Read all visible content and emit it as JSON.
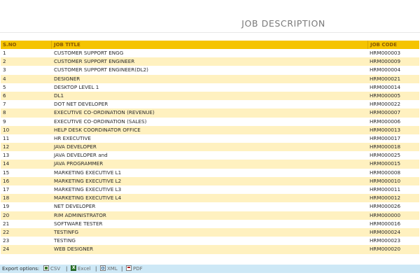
{
  "page_title": "JOB DESCRIPTION",
  "table": {
    "columns": [
      "S.NO",
      "JOB TITLE",
      "JOB CODE"
    ],
    "rows": [
      {
        "sno": "1",
        "title": "CUSTOMER SUPPORT ENGG",
        "code": "HRM000003"
      },
      {
        "sno": "2",
        "title": "CUSTOMER SUPPORT ENGINEER",
        "code": "HRM000009"
      },
      {
        "sno": "3",
        "title": "CUSTOMER SUPPORT ENGINEER(DL2)",
        "code": "HRM000004"
      },
      {
        "sno": "4",
        "title": "DESIGNER",
        "code": "HRM000021"
      },
      {
        "sno": "5",
        "title": "DESKTOP LEVEL 1",
        "code": "HRM000014"
      },
      {
        "sno": "6",
        "title": "DL1",
        "code": "HRM000005"
      },
      {
        "sno": "7",
        "title": "DOT NET DEVELOPER",
        "code": "HRM000022"
      },
      {
        "sno": "8",
        "title": "EXECUTIVE CO-ORDINATION (REVENUE)",
        "code": "HRM000007"
      },
      {
        "sno": "9",
        "title": "EXECUTIVE CO-ORDINATION (SALES)",
        "code": "HRM000006"
      },
      {
        "sno": "10",
        "title": "HELP DESK COORDINATOR OFFICE",
        "code": "HRM000013"
      },
      {
        "sno": "11",
        "title": "HR EXECUTIVE",
        "code": "HRM000017"
      },
      {
        "sno": "12",
        "title": "JAVA DEVELOPER",
        "code": "HRM000018"
      },
      {
        "sno": "13",
        "title": "JAVA DEVELOPER and",
        "code": "HRM000025"
      },
      {
        "sno": "14",
        "title": "JAVA PROGRAMMER",
        "code": "HRM000015"
      },
      {
        "sno": "15",
        "title": "MARKETING EXECUTIVE L1",
        "code": "HRM000008"
      },
      {
        "sno": "16",
        "title": "MARKETING EXECUTIVE L2",
        "code": "HRM000010"
      },
      {
        "sno": "17",
        "title": "MARKETING EXECUTIVE L3",
        "code": "HRM000011"
      },
      {
        "sno": "18",
        "title": "MARKETING EXECUTIVE L4",
        "code": "HRM000012"
      },
      {
        "sno": "19",
        "title": "NET DEVELOPER",
        "code": "HRM000026"
      },
      {
        "sno": "20",
        "title": "RIM ADMINISTRATOR",
        "code": "HRM000000"
      },
      {
        "sno": "21",
        "title": "SOFTWARE TESTER",
        "code": "HRM000016"
      },
      {
        "sno": "22",
        "title": "TESTINFG",
        "code": "HRM000024"
      },
      {
        "sno": "23",
        "title": "TESTING",
        "code": "HRM000023"
      },
      {
        "sno": "24",
        "title": "WEB DESIGNER",
        "code": "HRM000020"
      }
    ]
  },
  "export": {
    "label": "Export options:",
    "options": [
      {
        "label": "CSV",
        "icon": "csv-icon"
      },
      {
        "label": "Excel",
        "icon": "excel-icon"
      },
      {
        "label": "XML",
        "icon": "xml-icon"
      },
      {
        "label": "PDF",
        "icon": "pdf-icon"
      }
    ],
    "separator": "|"
  },
  "colors": {
    "header_bg": "#f5c400",
    "alt_row_bg": "#fff1c0",
    "footer_bg": "#cde8f6"
  }
}
